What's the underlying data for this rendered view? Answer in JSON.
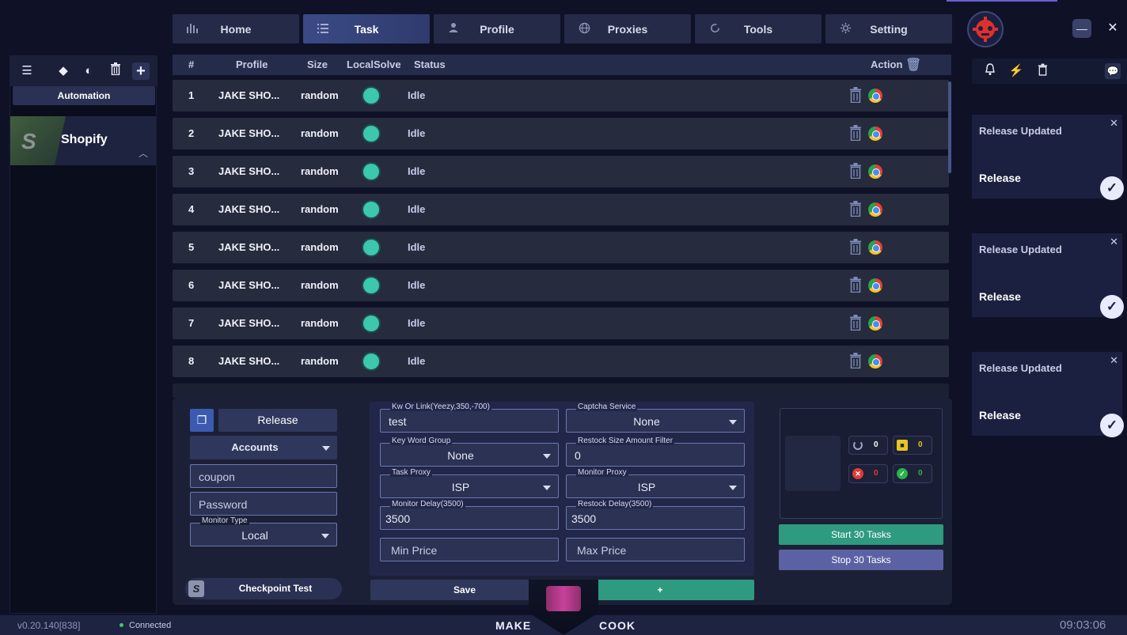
{
  "nav": {
    "tabs": [
      {
        "label": "Home",
        "icon": "bar-chart-icon"
      },
      {
        "label": "Task",
        "icon": "list-icon"
      },
      {
        "label": "Profile",
        "icon": "user-icon"
      },
      {
        "label": "Proxies",
        "icon": "globe-icon"
      },
      {
        "label": "Tools",
        "icon": "refresh-icon"
      },
      {
        "label": "Setting",
        "icon": "gear-icon"
      }
    ],
    "active_tab": "Task"
  },
  "sidebar": {
    "automation_label": "Automation",
    "store": {
      "name": "Shopify",
      "logo_letter": "S"
    }
  },
  "table": {
    "headers": {
      "num": "#",
      "profile": "Profile",
      "size": "Size",
      "solve": "LocalSolve",
      "status": "Status",
      "action": "Action"
    },
    "rows": [
      {
        "num": "1",
        "profile": "JAKE SHO...",
        "size": "random",
        "status": "Idle"
      },
      {
        "num": "2",
        "profile": "JAKE SHO...",
        "size": "random",
        "status": "Idle"
      },
      {
        "num": "3",
        "profile": "JAKE SHO...",
        "size": "random",
        "status": "Idle"
      },
      {
        "num": "4",
        "profile": "JAKE SHO...",
        "size": "random",
        "status": "Idle"
      },
      {
        "num": "5",
        "profile": "JAKE SHO...",
        "size": "random",
        "status": "Idle"
      },
      {
        "num": "6",
        "profile": "JAKE SHO...",
        "size": "random",
        "status": "Idle"
      },
      {
        "num": "7",
        "profile": "JAKE SHO...",
        "size": "random",
        "status": "Idle"
      },
      {
        "num": "8",
        "profile": "JAKE SHO...",
        "size": "random",
        "status": "Idle"
      }
    ]
  },
  "form": {
    "release_button": "Release",
    "accounts_select": "Accounts",
    "coupon_placeholder": "coupon",
    "password_placeholder": "Password",
    "monitor_type": {
      "label": "Monitor Type",
      "value": "Local"
    },
    "checkpoint_button": "Checkpoint Test",
    "kw": {
      "label": "Kw Or Link(Yeezy,350,-700)",
      "value": "test"
    },
    "captcha": {
      "label": "Captcha Service",
      "value": "None"
    },
    "keyword_group": {
      "label": "Key Word Group",
      "value": "None"
    },
    "restock_filter": {
      "label": "Restock Size Amount Filter",
      "value": "0"
    },
    "task_proxy": {
      "label": "Task Proxy",
      "value": "ISP"
    },
    "monitor_proxy": {
      "label": "Monitor Proxy",
      "value": "ISP"
    },
    "monitor_delay": {
      "label": "Monitor Delay(3500)",
      "value": "3500"
    },
    "restock_delay": {
      "label": "Restock Delay(3500)",
      "value": "3500"
    },
    "min_price_placeholder": "Min Price",
    "max_price_placeholder": "Max Price",
    "save_button": "Save",
    "add_button": "+"
  },
  "stats": {
    "running": "0",
    "locked": "0",
    "failed": "0",
    "success": "0",
    "start_button": "Start 30 Tasks",
    "stop_button": "Stop 30 Tasks"
  },
  "notifications": [
    {
      "title": "Release Updated",
      "body": "Release"
    },
    {
      "title": "Release Updated",
      "body": "Release"
    },
    {
      "title": "Release Updated",
      "body": "Release"
    }
  ],
  "footer": {
    "version": "v0.20.140[838]",
    "connection": "Connected",
    "brand_left": "MAKE",
    "brand_right": "COOK",
    "clock": "09:03:06"
  },
  "colors": {
    "background": "#0f1226",
    "accent_green": "#2e9a7f",
    "accent_purple": "#5c61a3",
    "solve_dot": "#3cc7ae"
  }
}
